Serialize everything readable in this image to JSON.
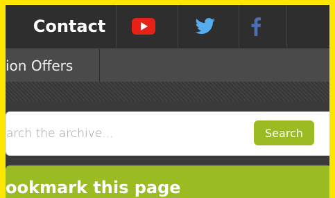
{
  "nav": {
    "contact_label": "Contact",
    "social": [
      {
        "icon": "youtube-icon",
        "color": "#e62117"
      },
      {
        "icon": "twitter-icon",
        "color": "#55acee"
      },
      {
        "icon": "facebook-icon",
        "color": "#3b5998"
      }
    ]
  },
  "subnav": {
    "item_label": "ion Offers"
  },
  "search": {
    "placeholder": "arch the archive...",
    "button_label": "Search",
    "accent": "#9bbb23"
  },
  "bookmark": {
    "title": "ookmark this page"
  }
}
